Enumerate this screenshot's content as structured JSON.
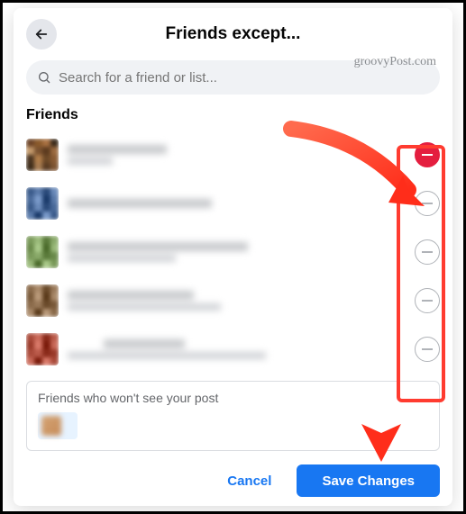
{
  "header": {
    "title": "Friends except..."
  },
  "watermark": "groovyPost.com",
  "search": {
    "placeholder": "Search for a friend or list..."
  },
  "section": {
    "friends_heading": "Friends"
  },
  "friends": [
    {
      "excluded": true
    },
    {
      "excluded": false
    },
    {
      "excluded": false
    },
    {
      "excluded": false
    },
    {
      "excluded": false
    }
  ],
  "excluded_box": {
    "label": "Friends who won't see your post"
  },
  "footer": {
    "cancel": "Cancel",
    "save": "Save Changes"
  },
  "icons": {
    "back": "arrow-left",
    "search": "magnifier",
    "exclude": "minus-circle"
  }
}
